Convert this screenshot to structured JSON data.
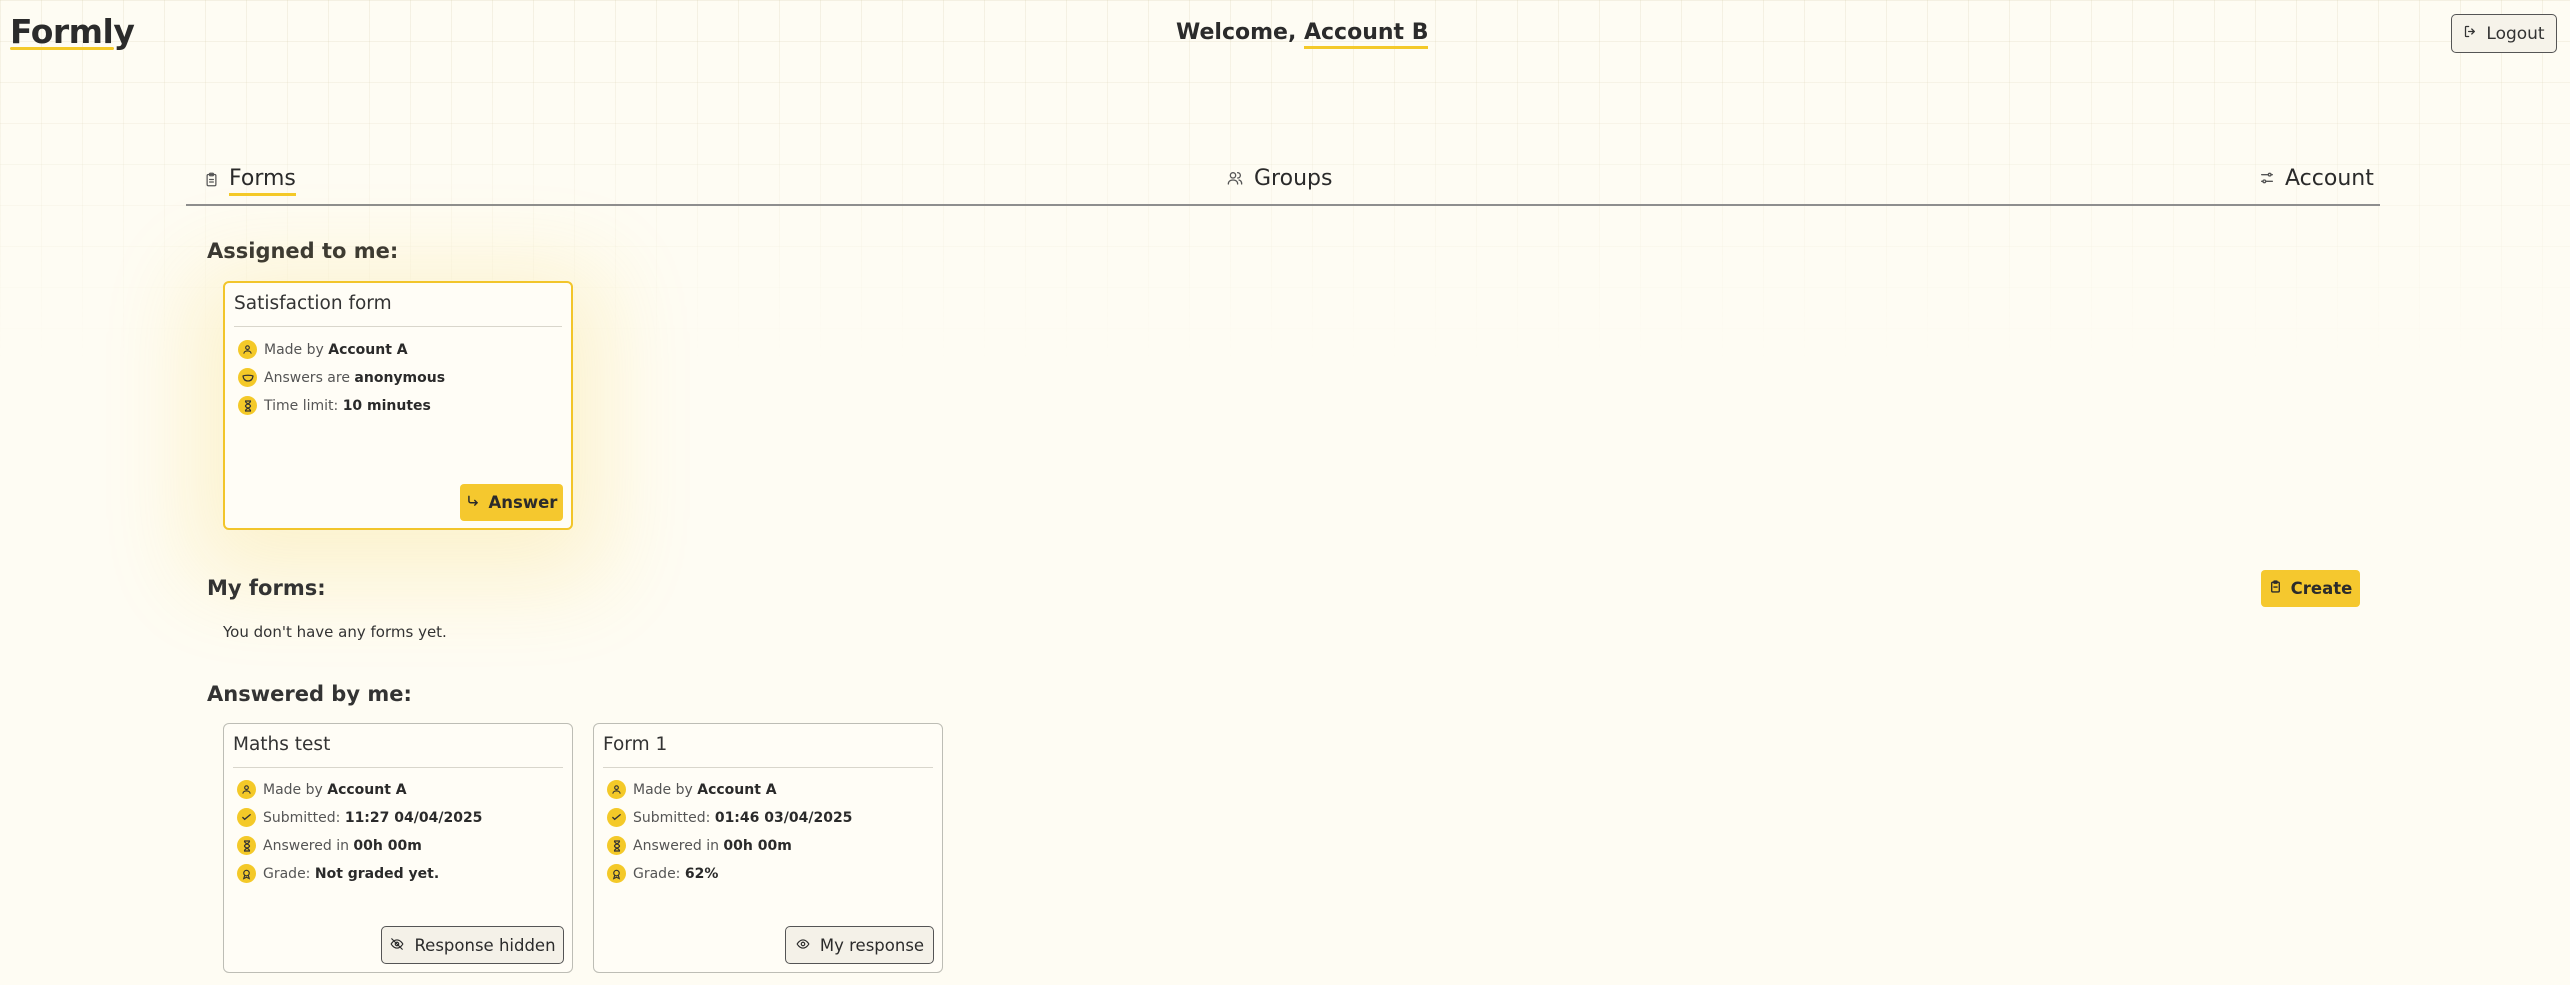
{
  "app": {
    "title": "Formly",
    "welcome_prefix": "Welcome, ",
    "user_name": "Account B",
    "logout_label": "Logout"
  },
  "tabs": [
    {
      "label": "Forms",
      "icon": "clipboard-icon",
      "active": true
    },
    {
      "label": "Groups",
      "icon": "users-icon",
      "active": false
    },
    {
      "label": "Account",
      "icon": "settings-sliders-icon",
      "active": false
    }
  ],
  "assigned": {
    "heading": "Assigned to me:",
    "cards": [
      {
        "title": "Satisfaction form",
        "rows": [
          {
            "icon": "user-icon",
            "prefix": "Made by ",
            "value": "Account A"
          },
          {
            "icon": "mask-icon",
            "prefix": "Answers are ",
            "value": "anonymous"
          },
          {
            "icon": "hourglass-icon",
            "prefix": "Time limit: ",
            "value": "10 minutes"
          }
        ],
        "button_label": "Answer"
      }
    ]
  },
  "my_forms": {
    "heading": "My forms:",
    "create_label": "Create",
    "empty_text": "You don't have any forms yet."
  },
  "answered": {
    "heading": "Answered by me:",
    "cards": [
      {
        "title": "Maths test",
        "rows": [
          {
            "icon": "user-icon",
            "prefix": "Made by ",
            "value": "Account A"
          },
          {
            "icon": "check-circle-icon",
            "prefix": "Submitted: ",
            "value": "11:27 04/04/2025"
          },
          {
            "icon": "hourglass-icon",
            "prefix": "Answered in ",
            "value": "00h 00m"
          },
          {
            "icon": "medal-icon",
            "prefix": "Grade: ",
            "value": "Not graded yet."
          }
        ],
        "button_label": "Response hidden"
      },
      {
        "title": "Form 1",
        "rows": [
          {
            "icon": "user-icon",
            "prefix": "Made by ",
            "value": "Account A"
          },
          {
            "icon": "check-circle-icon",
            "prefix": "Submitted: ",
            "value": "01:46 03/04/2025"
          },
          {
            "icon": "hourglass-icon",
            "prefix": "Answered in ",
            "value": "00h 00m"
          },
          {
            "icon": "medal-icon",
            "prefix": "Grade: ",
            "value": "62%"
          }
        ],
        "button_label": "My response"
      }
    ]
  },
  "colors": {
    "accent": "#f4c928",
    "background": "#fefcf3"
  }
}
